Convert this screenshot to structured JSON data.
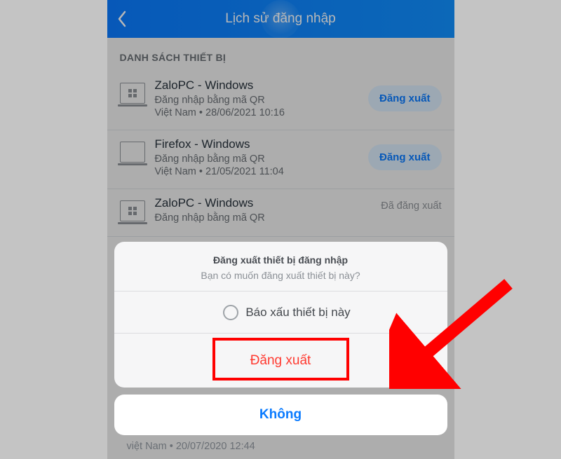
{
  "nav": {
    "title": "Lịch sử đăng nhập"
  },
  "section_header": "DANH SÁCH THIẾT BỊ",
  "logout_label": "Đăng xuất",
  "loggedout_label": "Đã đăng xuất",
  "devices": [
    {
      "name": "ZaloPC - Windows",
      "method": "Đăng nhập bằng mã QR",
      "meta": "Việt Nam • 28/06/2021 10:16",
      "status": "active"
    },
    {
      "name": "Firefox - Windows",
      "method": "Đăng nhập bằng mã QR",
      "meta": "Việt Nam • 21/05/2021 11:04",
      "status": "active"
    },
    {
      "name": "ZaloPC - Windows",
      "method": "Đăng nhập bằng mã QR",
      "meta": "",
      "status": "loggedout"
    }
  ],
  "peek_meta": "việt Nam • 20/07/2020 12:44",
  "sheet": {
    "title": "Đăng xuất thiết bị đăng nhập",
    "message": "Bạn có muốn đăng xuất thiết bị này?",
    "report": "Báo xấu thiết bị này",
    "confirm": "Đăng xuất",
    "cancel": "Không"
  }
}
